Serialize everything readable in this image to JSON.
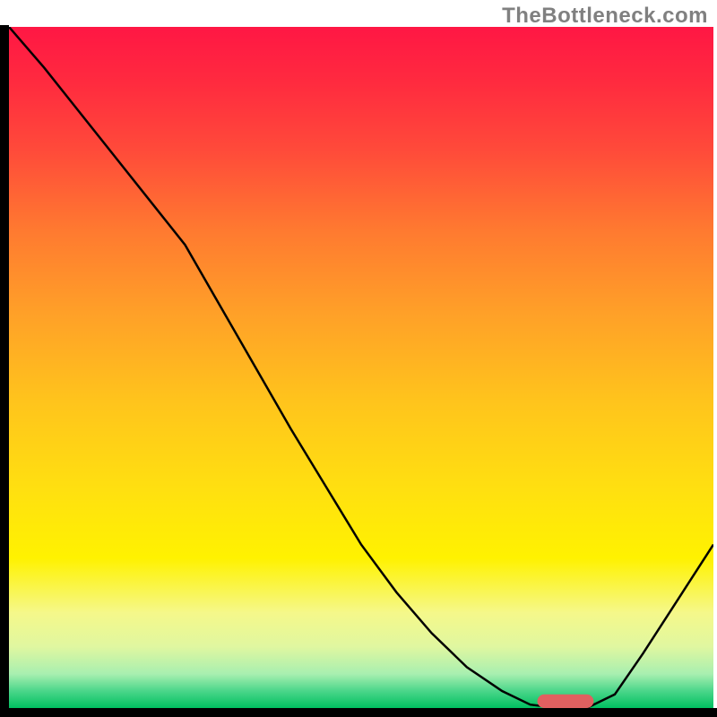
{
  "watermark": "TheBottleneck.com",
  "chart_data": {
    "type": "line",
    "title": "",
    "xlabel": "",
    "ylabel": "",
    "xlim": [
      0,
      100
    ],
    "ylim": [
      0,
      100
    ],
    "x": [
      0,
      5,
      10,
      15,
      20,
      25,
      30,
      35,
      40,
      45,
      50,
      55,
      60,
      65,
      70,
      74,
      78,
      82,
      86,
      90,
      95,
      100
    ],
    "values": [
      100,
      94,
      87.5,
      81,
      74.5,
      68,
      59,
      50,
      41,
      32.5,
      24,
      17,
      11,
      6,
      2.5,
      0.5,
      0,
      0,
      2,
      8,
      16,
      24
    ],
    "gradient_stops": [
      {
        "offset": 0.0,
        "color": "#ff1744"
      },
      {
        "offset": 0.08,
        "color": "#ff2a3f"
      },
      {
        "offset": 0.18,
        "color": "#ff4a3a"
      },
      {
        "offset": 0.3,
        "color": "#ff7a30"
      },
      {
        "offset": 0.42,
        "color": "#ffa028"
      },
      {
        "offset": 0.55,
        "color": "#ffc41c"
      },
      {
        "offset": 0.68,
        "color": "#ffe010"
      },
      {
        "offset": 0.78,
        "color": "#fff200"
      },
      {
        "offset": 0.86,
        "color": "#f5f88a"
      },
      {
        "offset": 0.91,
        "color": "#e0f7a0"
      },
      {
        "offset": 0.95,
        "color": "#a8efb0"
      },
      {
        "offset": 0.975,
        "color": "#4bd68a"
      },
      {
        "offset": 1.0,
        "color": "#00c060"
      }
    ],
    "marker": {
      "x_start": 75,
      "x_end": 83,
      "y": 0,
      "color": "#e06060",
      "thickness": 2.0
    },
    "axes": {
      "left_thickness": 10,
      "bottom_thickness": 10,
      "color": "#000000"
    }
  }
}
